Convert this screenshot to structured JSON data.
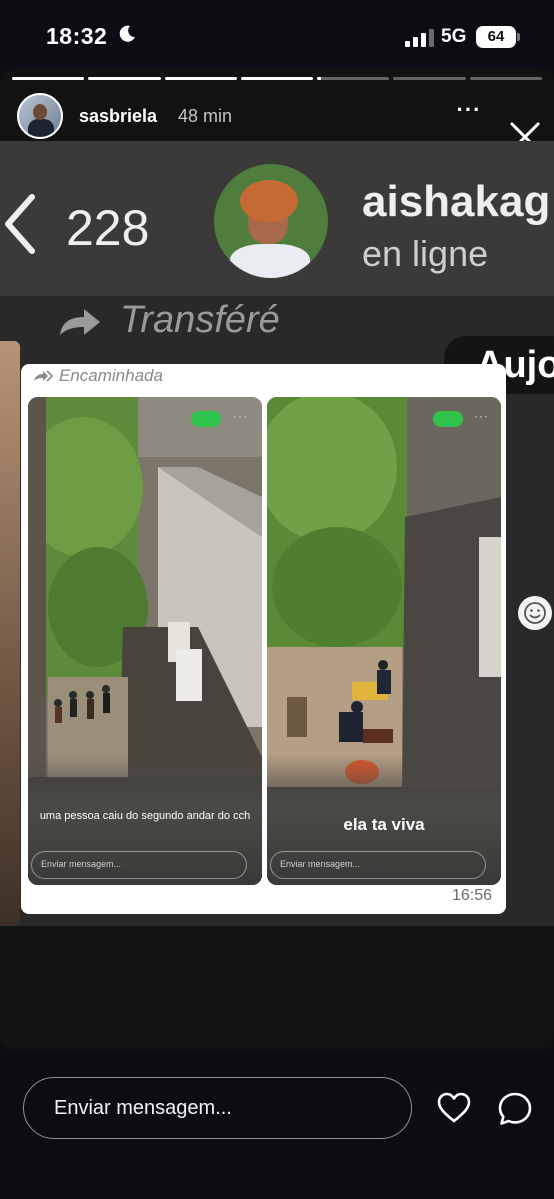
{
  "status_bar": {
    "time": "18:32",
    "network": "5G",
    "battery": "64"
  },
  "story": {
    "progress": {
      "total_segments": 7,
      "current_segment": 5,
      "current_fraction": 0.05
    },
    "username": "sasbriela",
    "posted_ago": "48 min",
    "more_icon": "more-horizontal-icon",
    "close_icon": "close-icon"
  },
  "chat_screenshot": {
    "unread_count": "228",
    "contact_name": "aishakag",
    "contact_status": "en ligne",
    "forwarded_label": "Transféré",
    "date_pill": "Aujo",
    "inner_forwarded_label": "Encaminhada",
    "message_time": "16:56",
    "phone_screens": [
      {
        "caption": "uma pessoa caiu do segundo andar do cch",
        "input_placeholder": "Enviar mensagem..."
      },
      {
        "caption": "ela ta viva",
        "input_placeholder": "Enviar mensagem..."
      }
    ]
  },
  "reply_bar": {
    "placeholder": "Enviar mensagem...",
    "like_icon": "heart-icon",
    "share_icon": "share-icon"
  }
}
